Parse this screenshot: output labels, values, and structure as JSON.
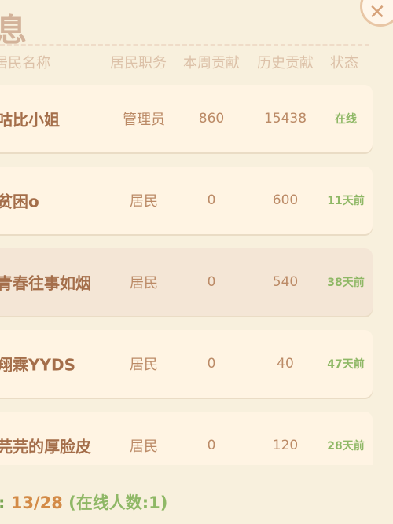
{
  "window": {
    "title": "息",
    "close_symbol": "✕"
  },
  "table": {
    "headers": {
      "name": "居民名称",
      "role": "居民职务",
      "weekly": "本周贡献",
      "history": "历史贡献",
      "status": "状态"
    },
    "rows": [
      {
        "name": "咕比小姐",
        "role": "管理员",
        "weekly": "860",
        "history": "15438",
        "status": "在线"
      },
      {
        "name": "贫困o",
        "role": "居民",
        "weekly": "0",
        "history": "600",
        "status": "11天前"
      },
      {
        "name": "青春往事如烟",
        "role": "居民",
        "weekly": "0",
        "history": "540",
        "status": "38天前"
      },
      {
        "name": "翔霖YYDS",
        "role": "居民",
        "weekly": "0",
        "history": "40",
        "status": "47天前"
      },
      {
        "name": "芫芫的厚脸皮",
        "role": "居民",
        "weekly": "0",
        "history": "120",
        "status": "28天前"
      }
    ]
  },
  "footer": {
    "colon": ":",
    "count": "13/28",
    "online": "(在线人数:1)"
  },
  "colors": {
    "accent": "#d38b47",
    "online_green": "#8fb866",
    "row_bg": "#fff4e3"
  }
}
